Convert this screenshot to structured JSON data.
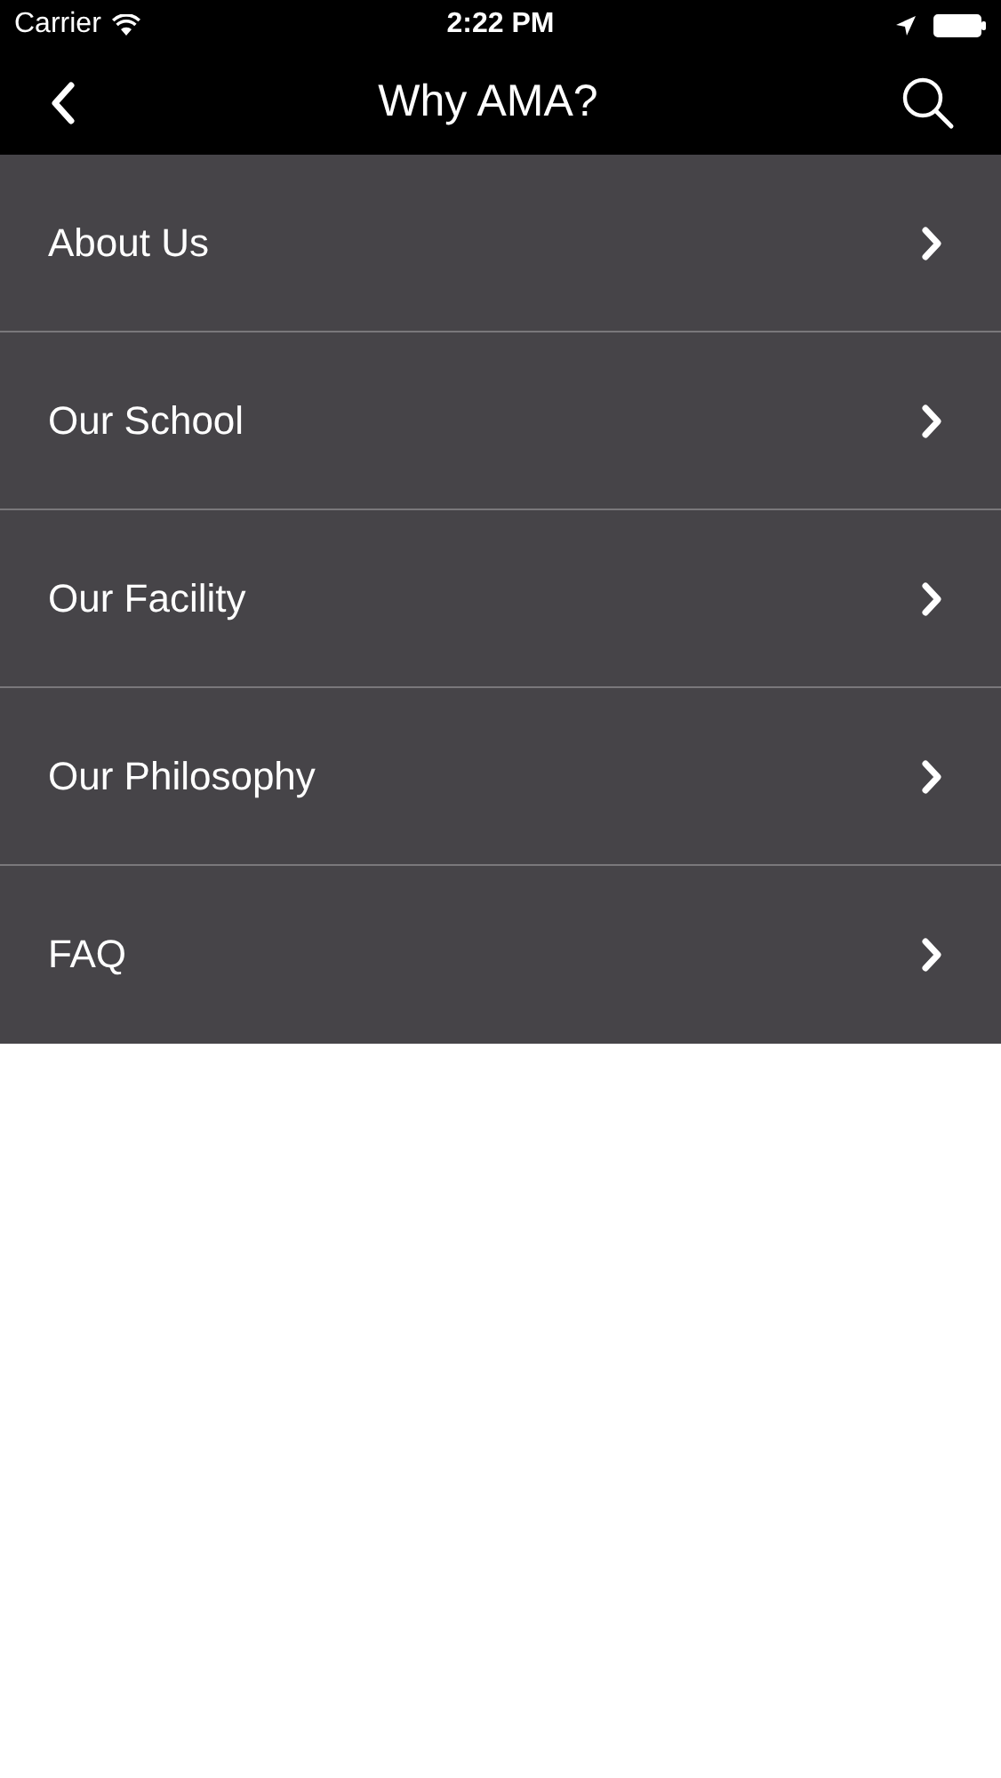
{
  "status_bar": {
    "carrier": "Carrier",
    "time": "2:22 PM"
  },
  "nav_bar": {
    "title": "Why AMA?"
  },
  "menu": [
    {
      "label": "About Us"
    },
    {
      "label": "Our School"
    },
    {
      "label": "Our Facility"
    },
    {
      "label": "Our Philosophy"
    },
    {
      "label": "FAQ"
    }
  ]
}
